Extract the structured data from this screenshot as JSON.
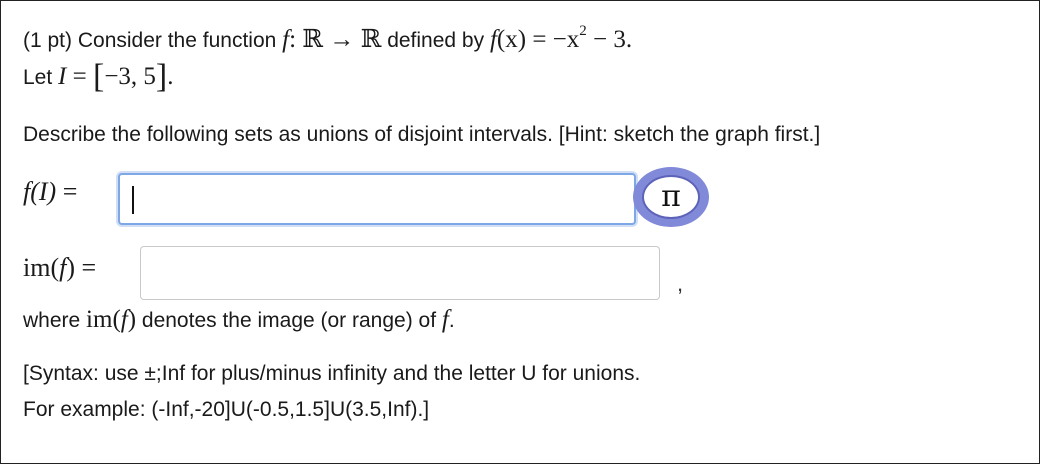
{
  "problem": {
    "intro_prefix": "(1 pt) Consider the function",
    "intro_func": "f",
    "intro_map": ": ℝ → ℝ",
    "intro_defined": "defined by",
    "intro_fx": "f",
    "intro_arg": "(x) = −x",
    "intro_exp": "2",
    "intro_rest": " − 3.",
    "let_prefix": "Let",
    "let_var": "I",
    "let_eq": " = ",
    "let_open": "[",
    "let_interval": "−3, 5",
    "let_close": "]",
    "let_end": ".",
    "instruction": "Describe the following sets as unions of disjoint intervals. [Hint: sketch the graph first.]"
  },
  "answer1": {
    "label_f": "f",
    "label_arg": "(I)",
    "label_eq": " =",
    "value": ""
  },
  "equation_button": {
    "symbol": "π"
  },
  "answer2": {
    "label": "im(",
    "label_f": "f",
    "label_close": ") =",
    "value": "",
    "trailing": ","
  },
  "where": {
    "prefix": "where",
    "im": "im(",
    "f": "f",
    "close": ")",
    "middle": "denotes the image (or range) of",
    "f2": "f",
    "end": "."
  },
  "syntax": {
    "line1": "[Syntax: use ±;Inf for plus/minus infinity and the letter U for unions.",
    "line2": "For example: (-Inf,-20]U(-0.5,1.5]U(3.5,Inf).]"
  }
}
